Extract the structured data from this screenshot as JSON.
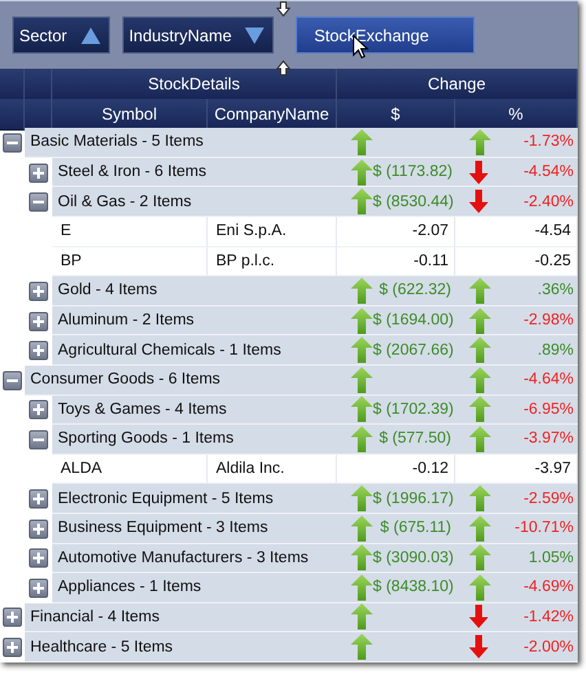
{
  "group_panel": {
    "chips": [
      {
        "label": "Sector",
        "descending": false,
        "selected": false
      },
      {
        "label": "IndustryName",
        "descending": true,
        "selected": false
      },
      {
        "label": "StockExchange",
        "selected": true
      }
    ]
  },
  "header": {
    "bands": [
      "StockDetails",
      "Change"
    ],
    "columns": [
      "Symbol",
      "CompanyName",
      "$",
      "%"
    ]
  },
  "sectors": [
    {
      "label": "Basic Materials - 5 Items",
      "expanded": true,
      "dollar_up": true,
      "pct_up": true,
      "pct": "-1.73%",
      "pct_negative": true,
      "industries": [
        {
          "label": "Steel & Iron - 6 Items",
          "expanded": false,
          "dollar_up": true,
          "dollar": "$ (1173.82)",
          "pct_up": false,
          "pct": "-4.54%",
          "pct_negative": true
        },
        {
          "label": "Oil & Gas - 2 Items",
          "expanded": true,
          "dollar_up": true,
          "dollar": "$ (8530.44)",
          "pct_up": false,
          "pct": "-2.40%",
          "pct_negative": true,
          "stocks": [
            {
              "symbol": "E",
              "company": "Eni S.p.A.",
              "change": "-2.07",
              "pct": "-4.54"
            },
            {
              "symbol": "BP",
              "company": "BP p.l.c.",
              "change": "-0.11",
              "pct": "-0.25"
            }
          ]
        },
        {
          "label": "Gold - 4 Items",
          "expanded": false,
          "dollar_up": true,
          "dollar": "$ (622.32)",
          "pct_up": true,
          "pct": ".36%",
          "pct_negative": false
        },
        {
          "label": "Aluminum - 2 Items",
          "expanded": false,
          "dollar_up": true,
          "dollar": "$ (1694.00)",
          "pct_up": true,
          "pct": "-2.98%",
          "pct_negative": true
        },
        {
          "label": "Agricultural Chemicals - 1 Items",
          "expanded": false,
          "dollar_up": true,
          "dollar": "$ (2067.66)",
          "pct_up": true,
          "pct": ".89%",
          "pct_negative": false
        }
      ]
    },
    {
      "label": "Consumer Goods - 6 Items",
      "expanded": true,
      "dollar_up": true,
      "pct_up": true,
      "pct": "-4.64%",
      "pct_negative": true,
      "industries": [
        {
          "label": "Toys & Games - 4 Items",
          "expanded": false,
          "dollar_up": true,
          "dollar": "$ (1702.39)",
          "pct_up": true,
          "pct": "-6.95%",
          "pct_negative": true
        },
        {
          "label": "Sporting Goods - 1 Items",
          "expanded": true,
          "dollar_up": true,
          "dollar": "$ (577.50)",
          "pct_up": true,
          "pct": "-3.97%",
          "pct_negative": true,
          "stocks": [
            {
              "symbol": "ALDA",
              "company": "Aldila Inc.",
              "change": "-0.12",
              "pct": "-3.97"
            }
          ]
        },
        {
          "label": "Electronic Equipment - 5 Items",
          "expanded": false,
          "dollar_up": true,
          "dollar": "$ (1996.17)",
          "pct_up": true,
          "pct": "-2.59%",
          "pct_negative": true
        },
        {
          "label": "Business Equipment - 3 Items",
          "expanded": false,
          "dollar_up": true,
          "dollar": "$ (675.11)",
          "pct_up": true,
          "pct": "-10.71%",
          "pct_negative": true
        },
        {
          "label": "Automotive Manufacturers - 3 Items",
          "expanded": false,
          "dollar_up": true,
          "dollar": "$ (3090.03)",
          "pct_up": true,
          "pct": "1.05%",
          "pct_negative": false
        },
        {
          "label": "Appliances - 1 Items",
          "expanded": false,
          "dollar_up": true,
          "dollar": "$ (8438.10)",
          "pct_up": true,
          "pct": "-4.69%",
          "pct_negative": true
        }
      ]
    },
    {
      "label": "Financial - 4 Items",
      "expanded": false,
      "dollar_up": true,
      "pct_up": false,
      "pct": "-1.42%",
      "pct_negative": true
    },
    {
      "label": "Healthcare - 5 Items",
      "expanded": false,
      "dollar_up": true,
      "pct_up": false,
      "pct": "-2.00%",
      "pct_negative": true
    }
  ]
}
